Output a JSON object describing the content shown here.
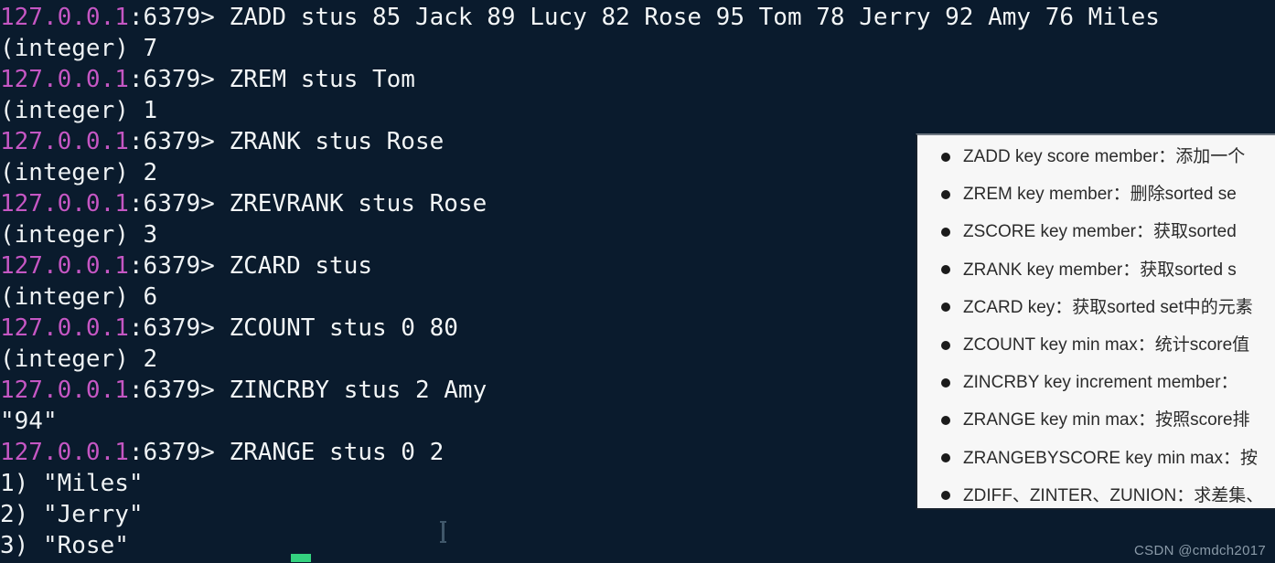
{
  "terminal": {
    "prompt_host": "127.0.0.1",
    "prompt_port": ":6379> ",
    "background_color": "#0a1b2d",
    "host_color": "#c457c4",
    "text_color": "#eef3f6",
    "cursor_color": "#34d27f",
    "lines": [
      {
        "type": "command",
        "host": "127.0.0.1",
        "port": ":6379> ",
        "text": "ZADD stus 85 Jack 89 Lucy 82 Rose 95 Tom 78 Jerry 92 Amy 76 Miles"
      },
      {
        "type": "reply",
        "text": "(integer) 7"
      },
      {
        "type": "command",
        "host": "127.0.0.1",
        "port": ":6379> ",
        "text": "ZREM stus Tom"
      },
      {
        "type": "reply",
        "text": "(integer) 1"
      },
      {
        "type": "command",
        "host": "127.0.0.1",
        "port": ":6379> ",
        "text": "ZRANK stus Rose"
      },
      {
        "type": "reply",
        "text": "(integer) 2"
      },
      {
        "type": "command",
        "host": "127.0.0.1",
        "port": ":6379> ",
        "text": "ZREVRANK stus Rose"
      },
      {
        "type": "reply",
        "text": "(integer) 3"
      },
      {
        "type": "command",
        "host": "127.0.0.1",
        "port": ":6379> ",
        "text": "ZCARD stus"
      },
      {
        "type": "reply",
        "text": "(integer) 6"
      },
      {
        "type": "command",
        "host": "127.0.0.1",
        "port": ":6379> ",
        "text": "ZCOUNT stus 0 80"
      },
      {
        "type": "reply",
        "text": "(integer) 2"
      },
      {
        "type": "command",
        "host": "127.0.0.1",
        "port": ":6379> ",
        "text": "ZINCRBY stus 2 Amy"
      },
      {
        "type": "reply",
        "text": "\"94\""
      },
      {
        "type": "command",
        "host": "127.0.0.1",
        "port": ":6379> ",
        "text": "ZRANGE stus 0 2"
      },
      {
        "type": "reply",
        "text": "1) \"Miles\""
      },
      {
        "type": "reply",
        "text": "2) \"Jerry\""
      },
      {
        "type": "reply",
        "text": "3) \"Rose\""
      }
    ]
  },
  "cheatsheet": {
    "background_color": "#f7f7f7",
    "items": [
      {
        "text": "ZADD key score member：添加一个"
      },
      {
        "text": "ZREM key member：删除sorted se"
      },
      {
        "text": "ZSCORE key member：获取sorted "
      },
      {
        "text": "ZRANK key member：获取sorted s"
      },
      {
        "text": "ZCARD key：获取sorted set中的元素"
      },
      {
        "text": "ZCOUNT key min max：统计score值"
      },
      {
        "text": "ZINCRBY key increment member："
      },
      {
        "text": "ZRANGE key min max：按照score排"
      },
      {
        "text": "ZRANGEBYSCORE key min max：按"
      },
      {
        "text": "ZDIFF、ZINTER、ZUNION：求差集、"
      }
    ]
  },
  "watermark": {
    "text": "CSDN @cmdch2017"
  }
}
